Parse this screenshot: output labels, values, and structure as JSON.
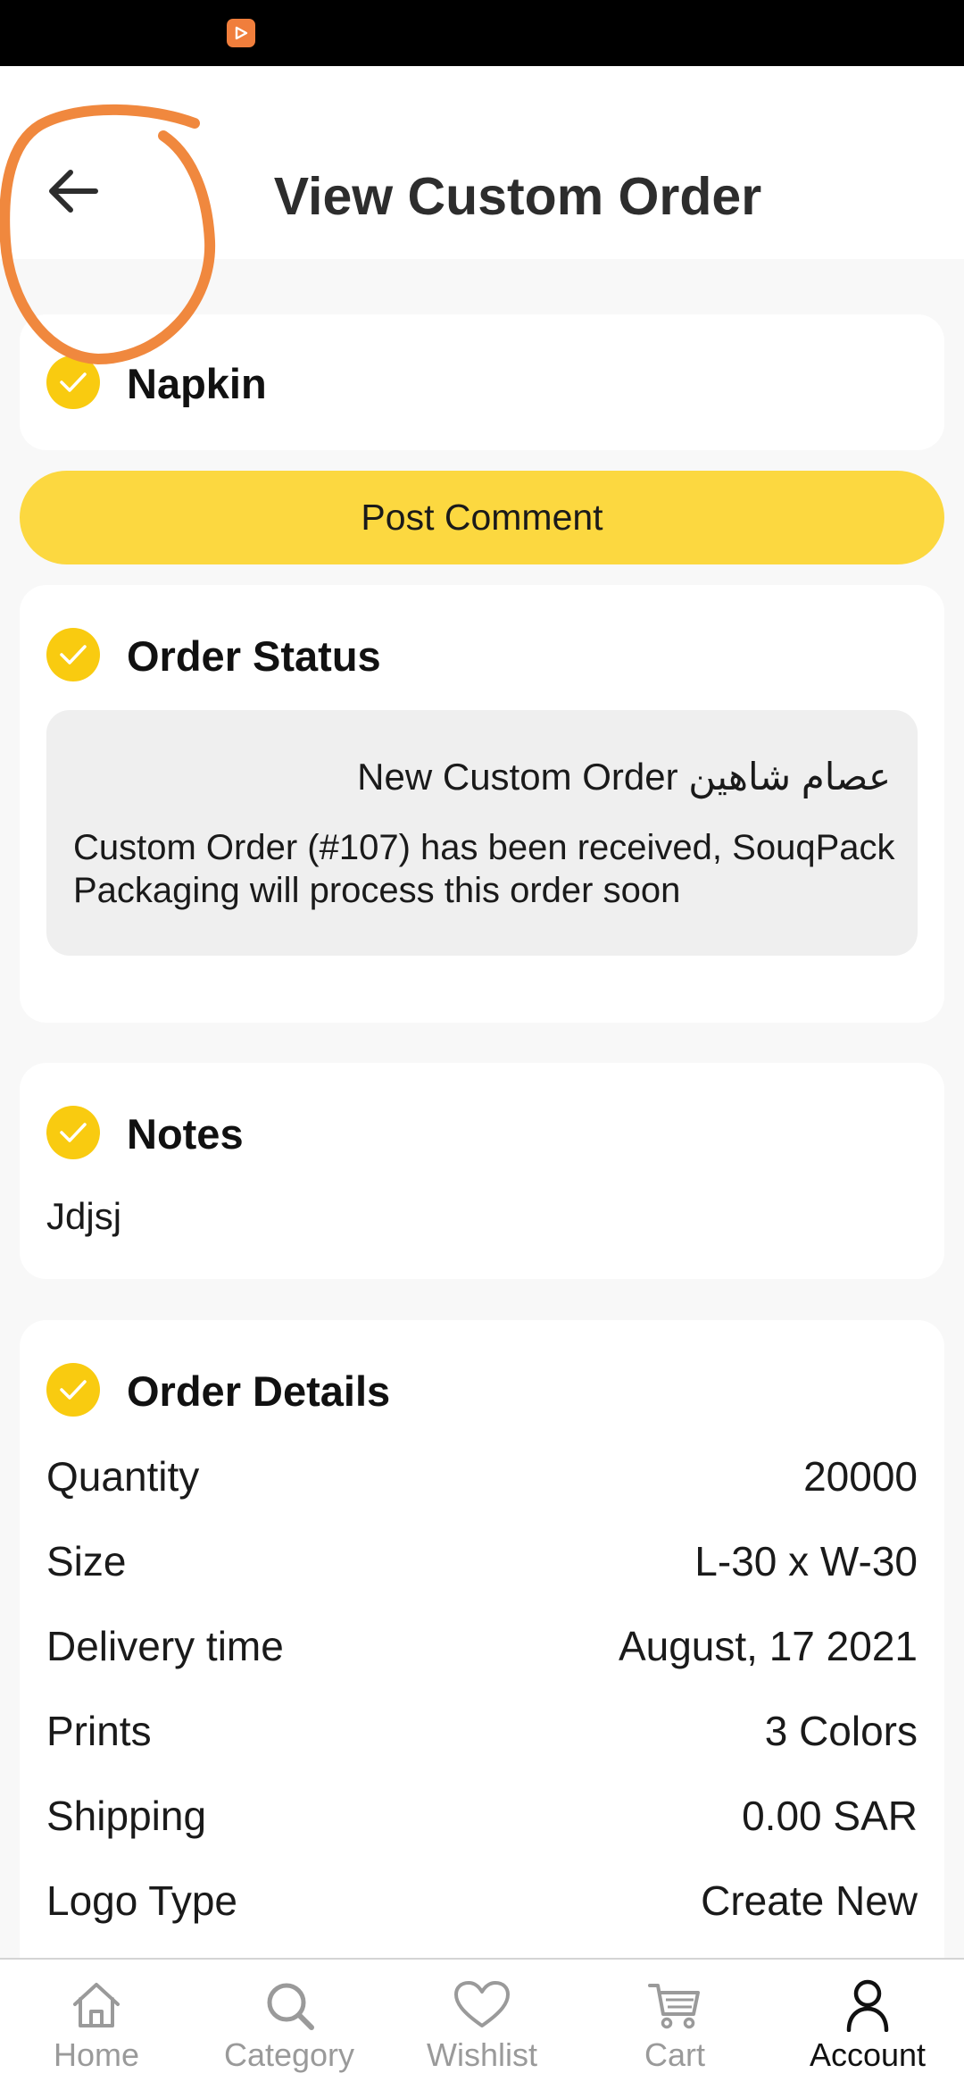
{
  "header": {
    "title": "View Custom Order"
  },
  "product": {
    "name": "Napkin"
  },
  "actions": {
    "post_comment_label": "Post Comment"
  },
  "order_status": {
    "heading": "Order Status",
    "message_title": "New Custom Order عصام شاهين",
    "message_body": "Custom Order (#107) has been received, SouqPack Packaging will process this order soon"
  },
  "notes": {
    "heading": "Notes",
    "text": "Jdjsj"
  },
  "order_details": {
    "heading": "Order Details",
    "rows": [
      {
        "label": "Quantity",
        "value": "20000"
      },
      {
        "label": "Size",
        "value": "L-30 x W-30"
      },
      {
        "label": "Delivery time",
        "value": "August, 17 2021"
      },
      {
        "label": "Prints",
        "value": "3 Colors"
      },
      {
        "label": "Shipping",
        "value": "0.00 SAR"
      },
      {
        "label": "Logo Type",
        "value": "Create New"
      }
    ]
  },
  "bottom_nav": {
    "items": [
      {
        "label": "Home",
        "icon": "home-icon"
      },
      {
        "label": "Category",
        "icon": "search-icon"
      },
      {
        "label": "Wishlist",
        "icon": "heart-icon"
      },
      {
        "label": "Cart",
        "icon": "cart-icon"
      },
      {
        "label": "Account",
        "icon": "user-icon",
        "active": true
      }
    ]
  },
  "colors": {
    "accent": "#fcd840",
    "check": "#f9cb10",
    "annotation": "#f0883e"
  }
}
